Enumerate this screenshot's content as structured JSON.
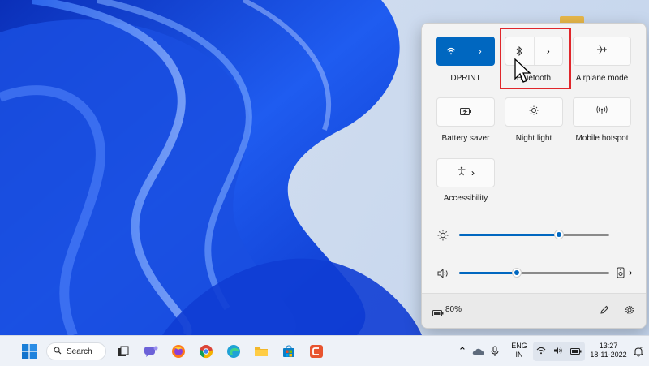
{
  "quick_settings": {
    "tiles": [
      {
        "id": "wifi",
        "label": "DPRINT",
        "active": true,
        "icon": "wifi-icon"
      },
      {
        "id": "bluetooth",
        "label": "Bluetooth",
        "active": false,
        "icon": "bluetooth-icon"
      },
      {
        "id": "airplane",
        "label": "Airplane mode",
        "active": false,
        "icon": "airplane-icon"
      },
      {
        "id": "battery_saver",
        "label": "Battery saver",
        "active": false,
        "icon": "battery-saver-icon"
      },
      {
        "id": "night_light",
        "label": "Night light",
        "active": false,
        "icon": "night-light-icon"
      },
      {
        "id": "mobile_hotspot",
        "label": "Mobile hotspot",
        "active": false,
        "icon": "mobile-hotspot-icon"
      },
      {
        "id": "accessibility",
        "label": "Accessibility",
        "active": false,
        "icon": "accessibility-icon"
      }
    ],
    "brightness_level": 0.66,
    "volume_level": 0.38,
    "battery_text": "80%"
  },
  "taskbar": {
    "search_label": "Search",
    "language": "ENG",
    "region": "IN",
    "time": "13:27",
    "date": "18-11-2022"
  },
  "colors": {
    "accent": "#0067c0",
    "highlight": "#e0262b"
  }
}
